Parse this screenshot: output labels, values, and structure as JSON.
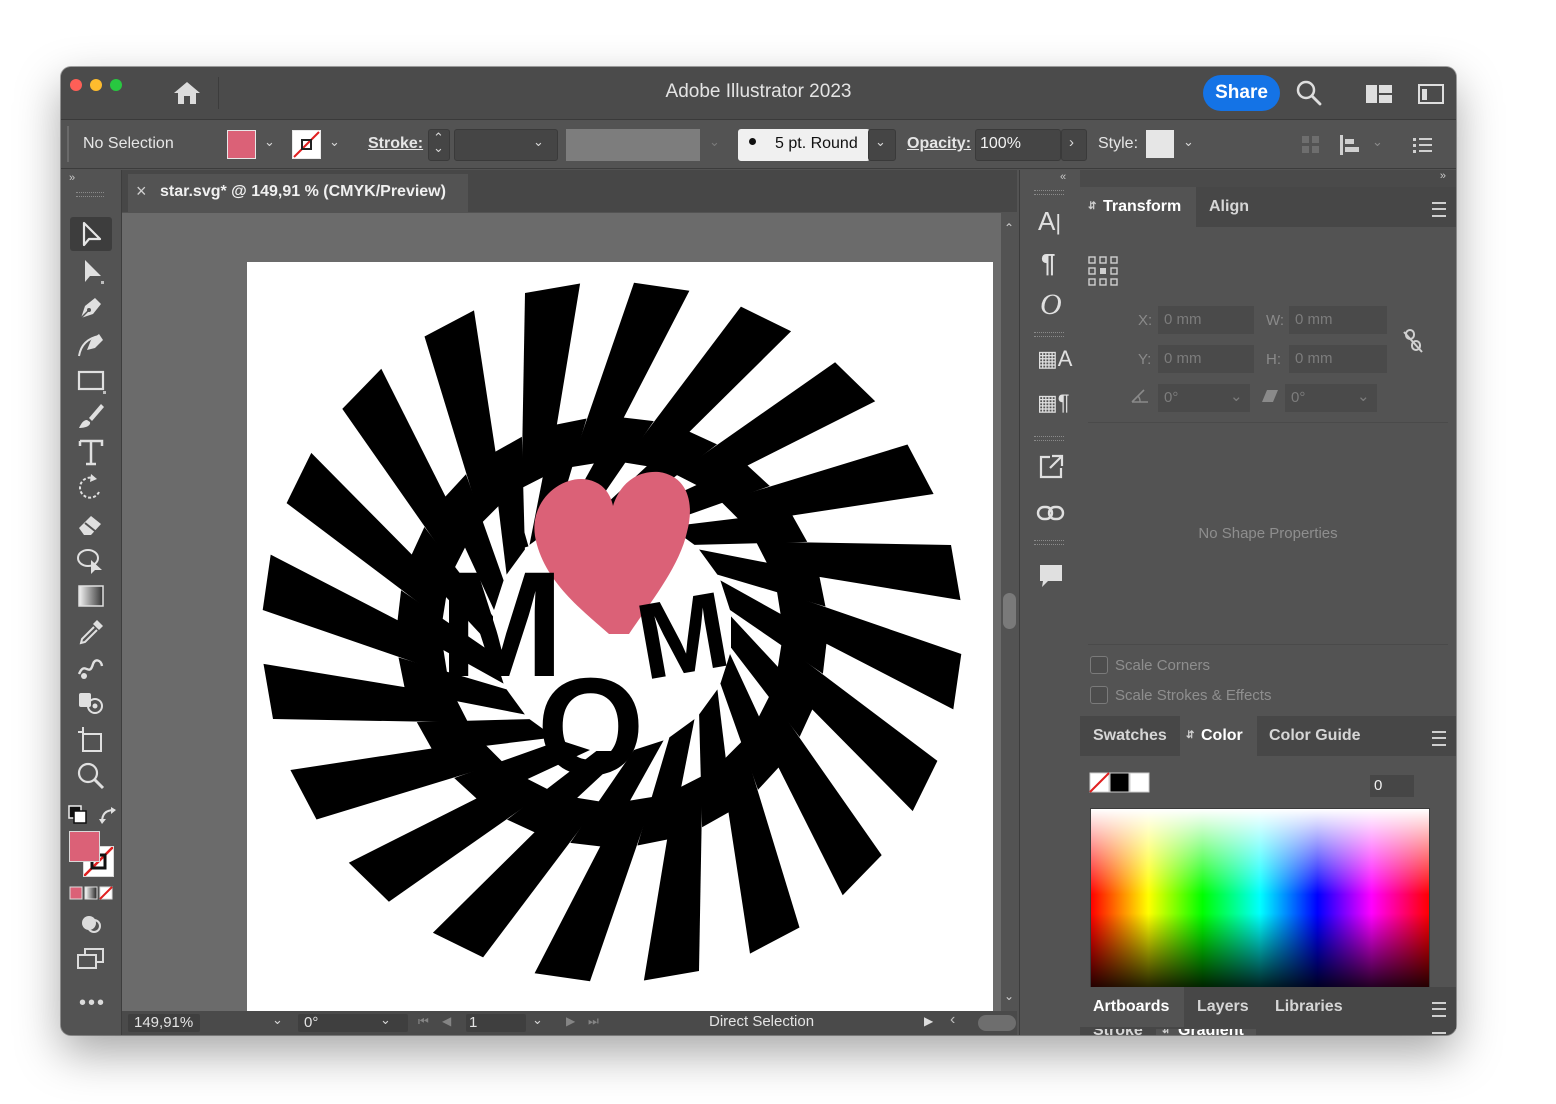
{
  "app": {
    "title": "Adobe Illustrator 2023",
    "share_label": "Share"
  },
  "control_bar": {
    "selection_label": "No Selection",
    "stroke_label": "Stroke:",
    "brush_label": "5 pt. Round",
    "opacity_label": "Opacity:",
    "opacity_value": "100%",
    "style_label": "Style:"
  },
  "colors": {
    "fill": "#db6177",
    "share_button": "#1473e6",
    "stroke": "none"
  },
  "document": {
    "tab_title": "star.svg* @ 149,91 % (CMYK/Preview)"
  },
  "artwork": {
    "letters": [
      "I",
      "M",
      "O",
      "M"
    ],
    "heart_color": "#db6177"
  },
  "toolbar": {
    "tools": [
      "direct-selection",
      "selection",
      "pen",
      "curvature",
      "rectangle",
      "paintbrush",
      "type",
      "rotate",
      "eraser",
      "shape-builder",
      "gradient",
      "eyedropper",
      "blend",
      "symbol-sprayer",
      "artboard",
      "zoom"
    ]
  },
  "status_bar": {
    "zoom": "149,91%",
    "rotation": "0°",
    "artboard_number": "1",
    "tool_name": "Direct Selection"
  },
  "transform_panel": {
    "tabs": [
      "Transform",
      "Align"
    ],
    "x_label": "X:",
    "x_value": "0 mm",
    "y_label": "Y:",
    "y_value": "0 mm",
    "w_label": "W:",
    "w_value": "0 mm",
    "h_label": "H:",
    "h_value": "0 mm",
    "rotate_value": "0°",
    "shear_value": "0°",
    "empty_message": "No Shape Properties",
    "scale_corners": "Scale Corners",
    "scale_strokes": "Scale Strokes & Effects"
  },
  "color_panel": {
    "tabs": [
      "Swatches",
      "Color",
      "Color Guide"
    ],
    "value": "0"
  },
  "gradient_panel": {
    "tabs": [
      "Stroke",
      "Gradient"
    ]
  },
  "bottom_panel": {
    "tabs": [
      "Artboards",
      "Layers",
      "Libraries"
    ]
  }
}
